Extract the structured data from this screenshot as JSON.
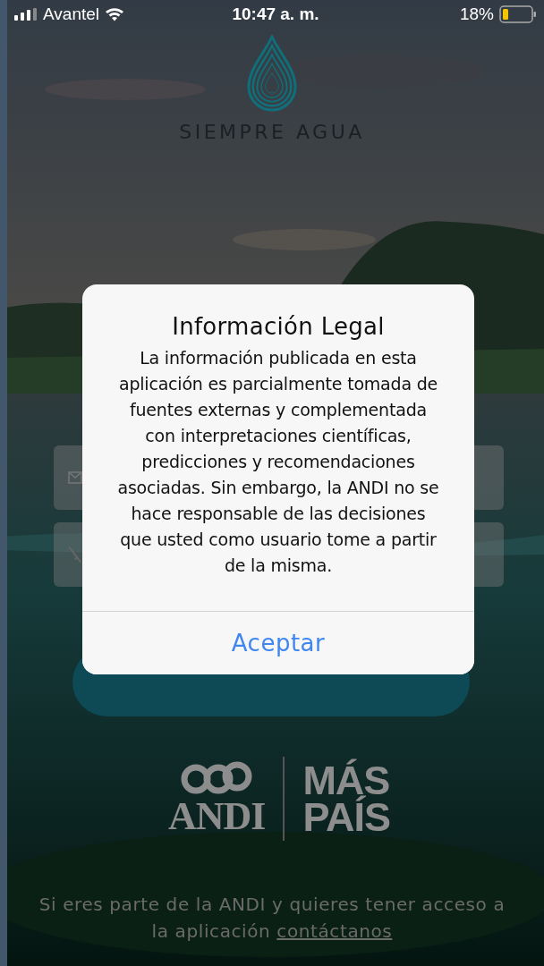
{
  "status_bar": {
    "carrier": "Avantel",
    "time": "10:47 a. m.",
    "battery": "18%"
  },
  "app": {
    "title": "SIEMPRE AGUA",
    "fields": [
      {
        "kind": "email"
      },
      {
        "kind": "password"
      }
    ],
    "partners": [
      {
        "kind": "andi",
        "lines": [
          "ANDI"
        ]
      },
      {
        "kind": "maspais",
        "lines": [
          "MÁS",
          "PAÍS"
        ]
      }
    ],
    "footer": {
      "text": "Si eres parte de la ANDI y quieres tener acceso a la aplicación",
      "link": "contáctanos"
    }
  },
  "dialog": {
    "title": "Información Legal",
    "message": "La información publicada en esta aplicación es parcialmente tomada de fuentes externas y complementada con interpretaciones científicas, predicciones y recomendaciones asociadas. Sin embargo, la ANDI no se hace responsable de las decisiones que usted como usuario tome a partir de la misma.",
    "button": "Aceptar"
  }
}
